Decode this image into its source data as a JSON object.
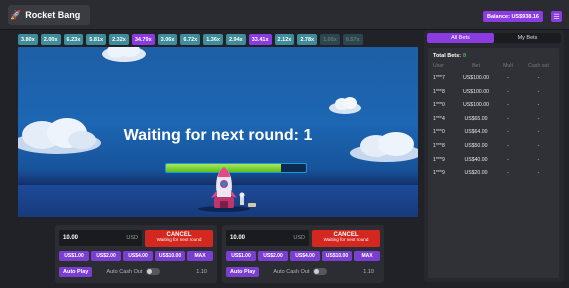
{
  "header": {
    "title": "Rocket Bang",
    "balance": "Balance: US$938.16",
    "menu_icon": "hamburger-icon"
  },
  "multipliers": [
    {
      "label": "3.80x",
      "color": "teal"
    },
    {
      "label": "2.00x",
      "color": "teal"
    },
    {
      "label": "6.23x",
      "color": "teal"
    },
    {
      "label": "5.81x",
      "color": "teal"
    },
    {
      "label": "2.32x",
      "color": "teal"
    },
    {
      "label": "34.79x",
      "color": "purple"
    },
    {
      "label": "3.06x",
      "color": "teal"
    },
    {
      "label": "6.72x",
      "color": "teal"
    },
    {
      "label": "1.36x",
      "color": "teal"
    },
    {
      "label": "2.94x",
      "color": "teal"
    },
    {
      "label": "33.41x",
      "color": "purple"
    },
    {
      "label": "2.12x",
      "color": "teal"
    },
    {
      "label": "2.78x",
      "color": "teal"
    },
    {
      "label": "1.05x",
      "color": "fade"
    },
    {
      "label": "6.57x",
      "color": "fade"
    }
  ],
  "game": {
    "status_text": "Waiting for next round: 1",
    "countdown_progress": 0.82
  },
  "bet_panels": [
    {
      "amount": "10.00",
      "currency": "USD",
      "cancel_label": "CANCEL",
      "cancel_sub": "Waiting for next round",
      "quick_bets": [
        "US$1.00",
        "US$2.00",
        "US$4.00",
        "US$10.00"
      ],
      "max_label": "MAX",
      "auto_play_label": "Auto Play",
      "auto_cash_out_label": "Auto Cash Out",
      "auto_cash_out_value": "1.10"
    },
    {
      "amount": "10.00",
      "currency": "USD",
      "cancel_label": "CANCEL",
      "cancel_sub": "Waiting for next round",
      "quick_bets": [
        "US$1.00",
        "US$2.00",
        "US$4.00",
        "US$10.00"
      ],
      "max_label": "MAX",
      "auto_play_label": "Auto Play",
      "auto_cash_out_label": "Auto Cash Out",
      "auto_cash_out_value": "1.10"
    }
  ],
  "sidebar": {
    "tabs": [
      "All Bets",
      "My Bets"
    ],
    "total_label": "Total Bets:",
    "total_count": "8",
    "columns": [
      "User",
      "Bet",
      "Mult",
      "Cash out"
    ],
    "rows": [
      {
        "user": "1***7",
        "bet": "US$100.00",
        "mult": "-",
        "cash": "-"
      },
      {
        "user": "1***8",
        "bet": "US$100.00",
        "mult": "-",
        "cash": "-"
      },
      {
        "user": "1***0",
        "bet": "US$100.00",
        "mult": "-",
        "cash": "-"
      },
      {
        "user": "1***4",
        "bet": "US$65.00",
        "mult": "-",
        "cash": "-"
      },
      {
        "user": "1***0",
        "bet": "US$64.00",
        "mult": "-",
        "cash": "-"
      },
      {
        "user": "1***8",
        "bet": "US$50.00",
        "mult": "-",
        "cash": "-"
      },
      {
        "user": "1***9",
        "bet": "US$40.00",
        "mult": "-",
        "cash": "-"
      },
      {
        "user": "1***9",
        "bet": "US$20.00",
        "mult": "-",
        "cash": "-"
      }
    ]
  }
}
